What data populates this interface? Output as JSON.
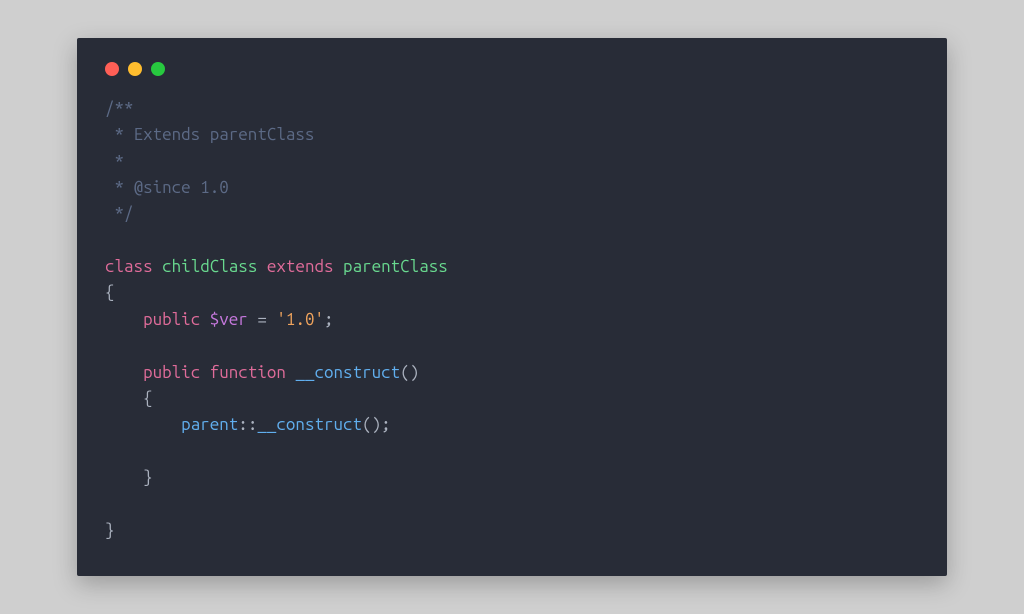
{
  "code": {
    "comment_open": "/**",
    "comment_line1": " * Extends parentClass",
    "comment_star": " *",
    "comment_line2": " * @since 1.0",
    "comment_close": " */",
    "kw_class": "class",
    "class_name": "childClass",
    "kw_extends": "extends",
    "parent_name": "parentClass",
    "brace_open": "{",
    "kw_public1": "public",
    "var_name": "$ver",
    "op_eq": " = ",
    "str_ver": "'1.0'",
    "semi": ";",
    "kw_public2": "public",
    "kw_function": "function",
    "fn_construct": "__construct",
    "parens": "()",
    "brace_open2": "{",
    "parent_call": "parent",
    "scope_op": "::",
    "fn_construct2": "__construct",
    "parens2": "()",
    "brace_close2": "}",
    "brace_close": "}"
  },
  "indent1": "    ",
  "indent2": "        "
}
